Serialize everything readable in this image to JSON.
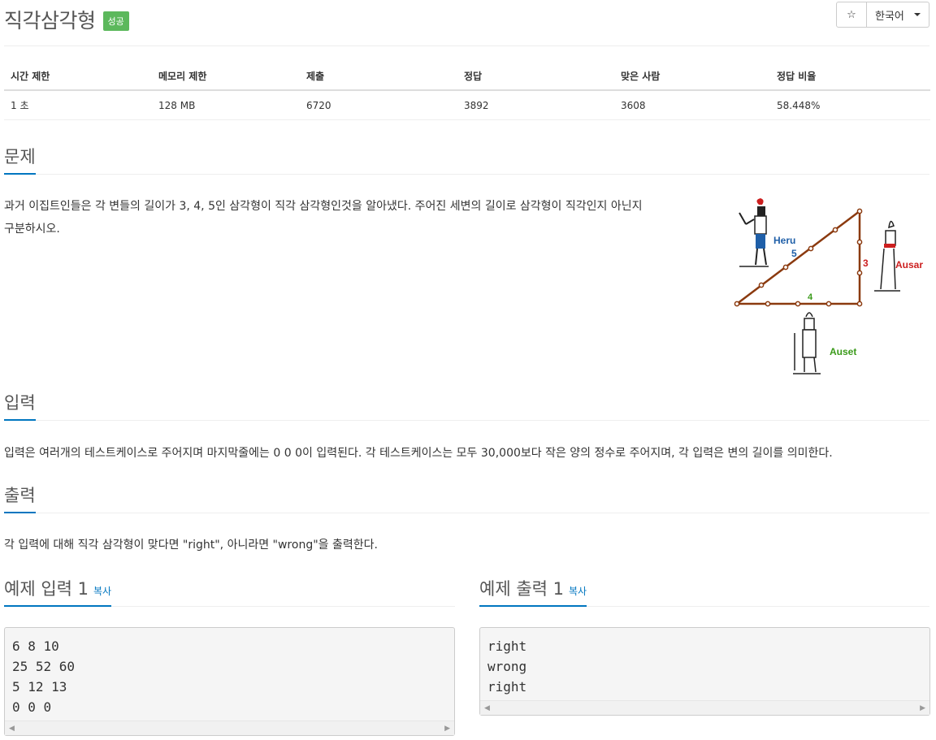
{
  "problem": {
    "title": "직각삼각형",
    "status_badge": "성공"
  },
  "toolbar": {
    "star_icon": "☆",
    "language": "한국어"
  },
  "stats": {
    "headers": [
      "시간 제한",
      "메모리 제한",
      "제출",
      "정답",
      "맞은 사람",
      "정답 비율"
    ],
    "values": [
      "1 초",
      "128 MB",
      "6720",
      "3892",
      "3608",
      "58.448%"
    ]
  },
  "sections": {
    "problem": {
      "heading": "문제",
      "text_line1": "과거 이집트인들은 각 변들의 길이가 3, 4, 5인 삼각형이 직각 삼각형인것을 알아냈다. 주어진 세변의 길이로 삼각형이 직각인지 아닌지",
      "text_line2": "구분하시오."
    },
    "input": {
      "heading": "입력",
      "text": "입력은 여러개의 테스트케이스로 주어지며 마지막줄에는 0 0 0이 입력된다. 각 테스트케이스는 모두 30,000보다 작은 양의 정수로 주어지며, 각 입력은 변의 길이를 의미한다."
    },
    "output": {
      "heading": "출력",
      "text": "각 입력에 대해 직각 삼각형이 맞다면 \"right\", 아니라면 \"wrong\"을 출력한다."
    }
  },
  "figure": {
    "labels": {
      "heru": "Heru",
      "ausar": "Ausar",
      "auset": "Auset",
      "side5": "5",
      "side3": "3",
      "side4": "4"
    },
    "colors": {
      "rope": "#8B3A0F",
      "heru": "#1f5fa8",
      "ausar": "#cc1f1f",
      "auset": "#3a9a1a"
    }
  },
  "samples": {
    "input": {
      "heading": "예제 입력 1",
      "copy_label": "복사",
      "content": "6 8 10\n25 52 60\n5 12 13\n0 0 0"
    },
    "output": {
      "heading": "예제 출력 1",
      "copy_label": "복사",
      "content": "right\nwrong\nright"
    }
  },
  "colors": {
    "accent": "#0076c0",
    "success": "#5cb85c"
  }
}
